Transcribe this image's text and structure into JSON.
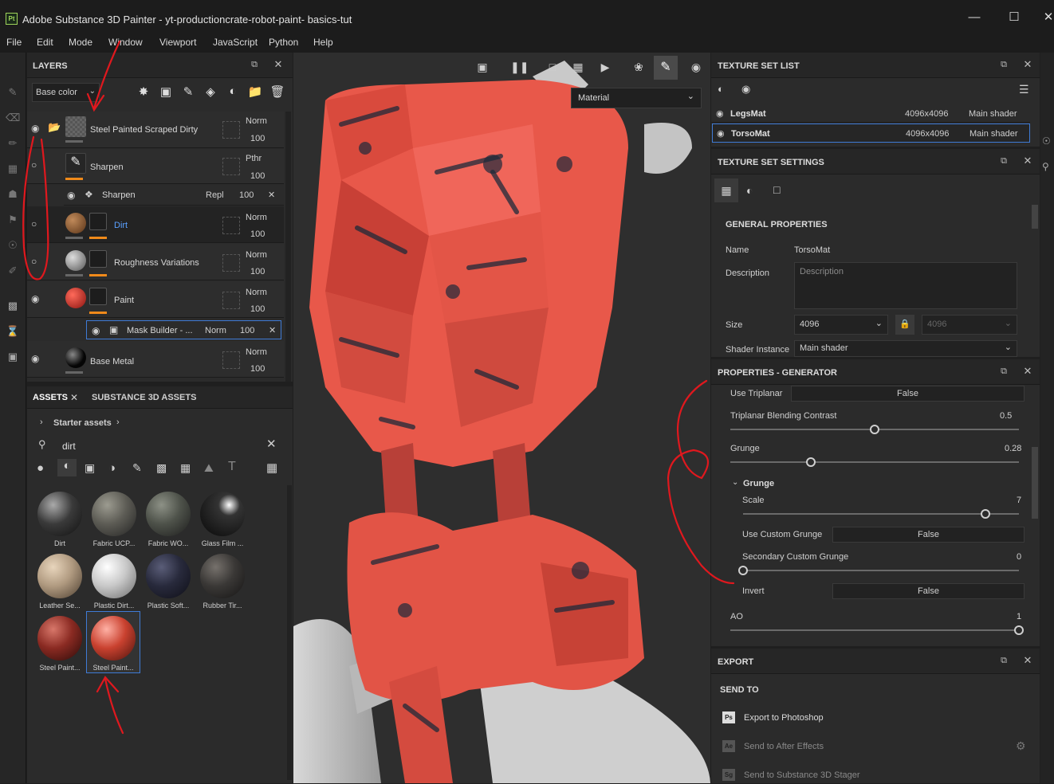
{
  "app": {
    "title": "Adobe Substance 3D Painter - yt-productioncrate-robot-paint- basics-tut",
    "logo": "Pt"
  },
  "menu": [
    "File",
    "Edit",
    "Mode",
    "Window",
    "Viewport",
    "JavaScript",
    "Python",
    "Help"
  ],
  "layers": {
    "title": "LAYERS",
    "channel": "Base color",
    "items": [
      {
        "name": "Steel Painted Scraped Dirty",
        "blend": "Norm",
        "opacity": "100"
      },
      {
        "name": "Sharpen",
        "blend": "Pthr",
        "opacity": "100"
      },
      {
        "name": "Sharpen",
        "blend": "Repl",
        "opacity": "100"
      },
      {
        "name": "Dirt",
        "blend": "Norm",
        "opacity": "100"
      },
      {
        "name": "Roughness Variations",
        "blend": "Norm",
        "opacity": "100"
      },
      {
        "name": "Paint",
        "blend": "Norm",
        "opacity": "100"
      },
      {
        "name": "Mask Builder - ...",
        "blend": "Norm",
        "opacity": "100"
      },
      {
        "name": "Base Metal",
        "blend": "Norm",
        "opacity": "100"
      }
    ]
  },
  "assets": {
    "tab1": "ASSETS",
    "tab2": "SUBSTANCE 3D ASSETS",
    "breadcrumb": "Starter assets",
    "search": "dirt",
    "items": [
      "Dirt",
      "Fabric UCP...",
      "Fabric WO...",
      "Glass Film ...",
      "Leather Se...",
      "Plastic Dirt...",
      "Plastic Soft...",
      "Rubber Tir...",
      "Steel Paint...",
      "Steel Paint..."
    ],
    "colors": [
      "#3a3a3a",
      "#5d5c55",
      "#4e524a",
      "#101010",
      "#b09a80",
      "#c8c8c8",
      "#282a3c",
      "#3a3836",
      "#8a2a22",
      "#c9412f"
    ]
  },
  "viewport": {
    "material": "Material"
  },
  "texture_set_list": {
    "title": "TEXTURE SET LIST",
    "rows": [
      {
        "name": "LegsMat",
        "size": "4096x4096",
        "shader": "Main shader"
      },
      {
        "name": "TorsoMat",
        "size": "4096x4096",
        "shader": "Main shader"
      }
    ]
  },
  "texture_set_settings": {
    "title": "TEXTURE SET SETTINGS",
    "section": "GENERAL PROPERTIES",
    "name_label": "Name",
    "name_value": "TorsoMat",
    "desc_label": "Description",
    "desc_placeholder": "Description",
    "size_label": "Size",
    "size_value": "4096",
    "size_value2": "4096",
    "shader_label": "Shader Instance",
    "shader_value": "Main shader"
  },
  "generator": {
    "title": "PROPERTIES - GENERATOR",
    "use_triplanar_label": "Use Triplanar",
    "use_triplanar": "False",
    "tbc_label": "Triplanar Blending Contrast",
    "tbc": "0.5",
    "tbc_fraction": 0.5,
    "grunge_label": "Grunge",
    "grunge": "0.28",
    "grunge_fraction": 0.28,
    "group": "Grunge",
    "scale_label": "Scale",
    "scale": "7",
    "scale_fraction": 0.88,
    "custom_label": "Use Custom Grunge",
    "custom": "False",
    "secondary_label": "Secondary Custom Grunge",
    "secondary": "0",
    "secondary_fraction": 0,
    "invert_label": "Invert",
    "invert": "False",
    "ao_label": "AO",
    "ao": "1",
    "ao_fraction": 1
  },
  "export": {
    "title": "EXPORT",
    "section": "SEND TO",
    "items": [
      "Export to Photoshop",
      "Send to After Effects",
      "Send to Substance 3D Stager"
    ],
    "icons": [
      "Ps",
      "Ae",
      "Sg"
    ]
  }
}
